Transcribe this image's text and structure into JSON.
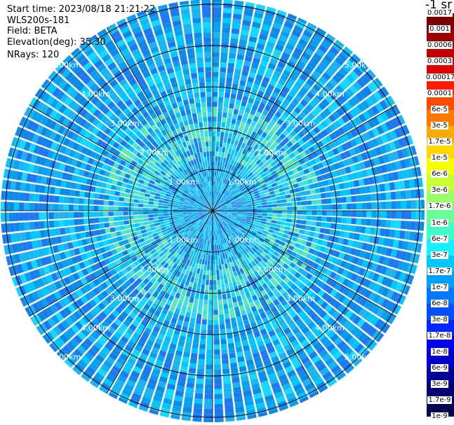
{
  "header": {
    "start_time": "Start time: 2023/08/18 21:21:22",
    "instrument": "WLS200s-181",
    "field": "Field: BETA",
    "elevation": "Elevation(deg): 35.30",
    "nrays": "NRays: 120"
  },
  "colorbar": {
    "title": "-1 sr",
    "labels": [
      "0.0017",
      "0.001",
      "0.0006",
      "0.0003",
      "0.00017",
      "0.0001",
      "6e-5",
      "3e-5",
      "1.7e-5",
      "1e-5",
      "6e-6",
      "3e-6",
      "1.7e-6",
      "1e-6",
      "6e-7",
      "3e-7",
      "1.7e-7",
      "1e-7",
      "6e-8",
      "3e-8",
      "1.7e-8",
      "1e-8",
      "6e-9",
      "3e-9",
      "1.7e-9",
      "1e-9"
    ],
    "colors": [
      "#7a0000",
      "#9c0000",
      "#c00000",
      "#e40000",
      "#ff1c00",
      "#ff4a00",
      "#ff7a00",
      "#ffaa00",
      "#ffd600",
      "#f6ff00",
      "#c8ff30",
      "#96ff66",
      "#68ff96",
      "#3cffc8",
      "#14f0ff",
      "#00c8ff",
      "#00a0ff",
      "#0078ff",
      "#0050ff",
      "#0028ff",
      "#0000f0",
      "#0000c8",
      "#00009a",
      "#000070",
      "#000050",
      "#000030"
    ]
  },
  "chart_data": {
    "type": "heatmap",
    "projection": "polar (PPI)",
    "field": "BETA",
    "nrays": 120,
    "range_km": [
      0,
      5.5
    ],
    "range_ring_labels": [
      "1.00km",
      "2.00km",
      "3.00km",
      "4.00km",
      "5.00km"
    ],
    "spoke_step_deg": 30,
    "value_scale": "log",
    "value_range": [
      1e-09,
      0.0017
    ],
    "typical_value_near_center": 1.7e-07,
    "typical_value_outer": 6e-08
  }
}
